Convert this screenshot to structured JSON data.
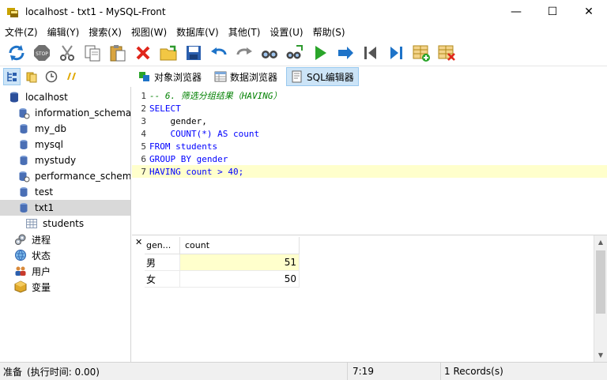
{
  "window": {
    "title": "localhost - txt1 - MySQL-Front",
    "minimize": "—",
    "maximize": "☐",
    "close": "✕"
  },
  "menu": [
    "文件(Z)",
    "编辑(Y)",
    "搜索(X)",
    "视图(W)",
    "数据库(V)",
    "其他(T)",
    "设置(U)",
    "帮助(S)"
  ],
  "toolbar": {
    "icons": [
      "refresh-icon",
      "stop-icon",
      "cut-icon",
      "copy-icon",
      "paste-icon",
      "delete-icon",
      "open-icon",
      "save-icon",
      "undo-icon",
      "redo-icon",
      "find-icon",
      "replace-icon",
      "run-icon",
      "run-to-cursor-icon",
      "first-icon",
      "last-icon",
      "insert-row-icon",
      "delete-row-icon"
    ]
  },
  "views": {
    "object_browser": "对象浏览器",
    "data_browser": "数据浏览器",
    "sql_editor": "SQL编辑器"
  },
  "tree": [
    {
      "label": "localhost",
      "level": 0,
      "icon": "server-icon"
    },
    {
      "label": "information_schema",
      "level": 1,
      "icon": "system-db-icon"
    },
    {
      "label": "my_db",
      "level": 1,
      "icon": "database-icon"
    },
    {
      "label": "mysql",
      "level": 1,
      "icon": "database-icon"
    },
    {
      "label": "mystudy",
      "level": 1,
      "icon": "database-icon"
    },
    {
      "label": "performance_schema",
      "level": 1,
      "icon": "system-db-icon"
    },
    {
      "label": "test",
      "level": 1,
      "icon": "database-icon"
    },
    {
      "label": "txt1",
      "level": 1,
      "icon": "database-icon",
      "selected": true
    },
    {
      "label": "students",
      "level": 2,
      "icon": "table-icon"
    },
    {
      "label": "进程",
      "level": 1,
      "icon": "processes-icon"
    },
    {
      "label": "状态",
      "level": 1,
      "icon": "status-icon"
    },
    {
      "label": "用户",
      "level": 1,
      "icon": "users-icon"
    },
    {
      "label": "变量",
      "level": 1,
      "icon": "variables-icon"
    }
  ],
  "editor": {
    "lines": [
      {
        "n": "1",
        "text": "-- 6. 筛选分组结果（HAVING）"
      },
      {
        "n": "2",
        "text": "SELECT"
      },
      {
        "n": "3",
        "text": "    gender,"
      },
      {
        "n": "4",
        "text": "    COUNT(*) AS count"
      },
      {
        "n": "5",
        "text": "FROM students"
      },
      {
        "n": "6",
        "text": "GROUP BY gender"
      },
      {
        "n": "7",
        "text": "HAVING count > 40;"
      }
    ]
  },
  "results": {
    "close": "✕",
    "columns": [
      "gen...",
      "count"
    ],
    "rows": [
      {
        "gender": "男",
        "count": "51"
      },
      {
        "gender": "女",
        "count": "50"
      }
    ]
  },
  "status": {
    "ready": "准备",
    "exec_time": "(执行时间: 0.00)",
    "position": "7:19",
    "records": "1 Records(s)"
  }
}
